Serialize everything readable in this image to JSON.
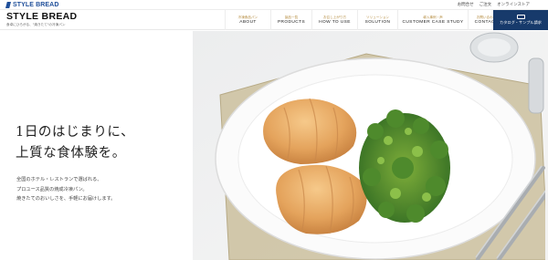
{
  "topbar": {
    "logo_text": "STYLE BREAD",
    "links": [
      "お問合せ",
      "ご注文",
      "オンラインストア"
    ]
  },
  "header": {
    "brand_name": "STYLE BREAD",
    "brand_tagline": "食卓にひろがる、\"焼きたて\"の冷凍パン"
  },
  "nav": [
    {
      "jp": "冷凍食品パン",
      "en": "ABOUT"
    },
    {
      "jp": "製品一覧",
      "en": "PRODUCTS"
    },
    {
      "jp": "お召し上がり方",
      "en": "HOW TO USE"
    },
    {
      "jp": "ソリューション",
      "en": "SOLUTION"
    },
    {
      "jp": "導入事例・声",
      "en": "CUSTOMER CASE STUDY"
    },
    {
      "jp": "お問い合わせ",
      "en": "CONTACT"
    }
  ],
  "cta": {
    "label": "カタログ・サンプル請求"
  },
  "hero": {
    "headline_line1": "1日のはじまりに、",
    "headline_line2": "上質な食体験を。",
    "body_line1": "全国のホテル・レストランで選ばれる、",
    "body_line2": "プロユース品質の焼成冷凍パン。",
    "body_line3": "焼きたてのおいしさを、手軽にお届けします。"
  },
  "colors": {
    "brand_blue": "#1f4f9a",
    "cta_navy": "#173a6b",
    "accent_gold": "#b48a3c"
  }
}
